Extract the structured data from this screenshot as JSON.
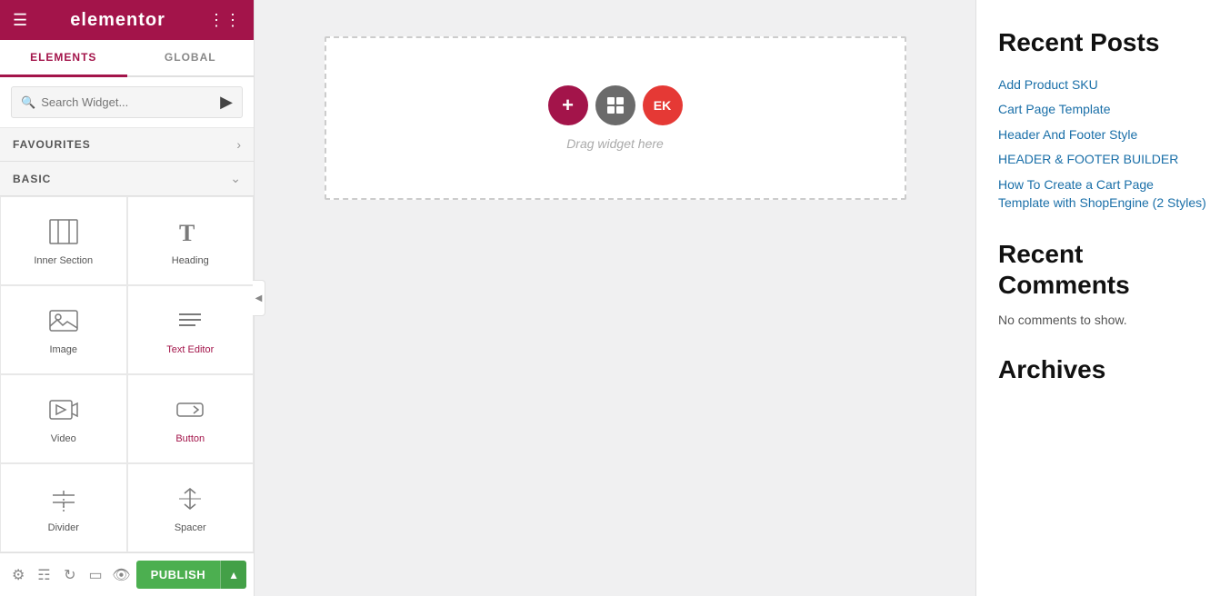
{
  "sidebar": {
    "logo": "elementor",
    "tabs": [
      {
        "id": "elements",
        "label": "ELEMENTS",
        "active": true
      },
      {
        "id": "global",
        "label": "GLOBAL",
        "active": false
      }
    ],
    "search": {
      "placeholder": "Search Widget..."
    },
    "favourites_label": "FAVOURITES",
    "basic_label": "BASIC",
    "widgets": [
      {
        "id": "inner-section",
        "label": "Inner Section",
        "icon": "inner-section-icon",
        "highlighted": false
      },
      {
        "id": "heading",
        "label": "Heading",
        "icon": "heading-icon",
        "highlighted": false
      },
      {
        "id": "image",
        "label": "Image",
        "icon": "image-icon",
        "highlighted": false
      },
      {
        "id": "text-editor",
        "label": "Text Editor",
        "icon": "text-editor-icon",
        "highlighted": true
      },
      {
        "id": "video",
        "label": "Video",
        "icon": "video-icon",
        "highlighted": false
      },
      {
        "id": "button",
        "label": "Button",
        "icon": "button-icon",
        "highlighted": true
      },
      {
        "id": "divider",
        "label": "Divider",
        "icon": "divider-icon",
        "highlighted": false
      },
      {
        "id": "spacer",
        "label": "Spacer",
        "icon": "spacer-icon",
        "highlighted": false
      }
    ],
    "bottom_icons": [
      {
        "id": "settings",
        "label": "settings-icon"
      },
      {
        "id": "layers",
        "label": "layers-icon"
      },
      {
        "id": "undo",
        "label": "undo-icon"
      },
      {
        "id": "responsive",
        "label": "responsive-icon"
      },
      {
        "id": "eye",
        "label": "eye-icon"
      }
    ],
    "publish_label": "PUBLISH",
    "publish_arrow": "▲"
  },
  "canvas": {
    "drop_label": "Drag widget here",
    "add_btn_symbol": "+",
    "section_btn_symbol": "▣",
    "ek_btn_symbol": "EK"
  },
  "right_panel": {
    "recent_posts_title": "Recent Posts",
    "posts": [
      {
        "label": "Add Product SKU",
        "url": "#"
      },
      {
        "label": "Cart Page Template",
        "url": "#"
      },
      {
        "label": "Header And Footer Style",
        "url": "#"
      },
      {
        "label": "HEADER & FOOTER BUILDER",
        "url": "#"
      },
      {
        "label": "How To Create a Cart Page Template with ShopEngine (2 Styles)",
        "url": "#"
      }
    ],
    "recent_comments_title": "Recent Comments",
    "no_comments_label": "No comments to show.",
    "archives_title": "Archives"
  }
}
